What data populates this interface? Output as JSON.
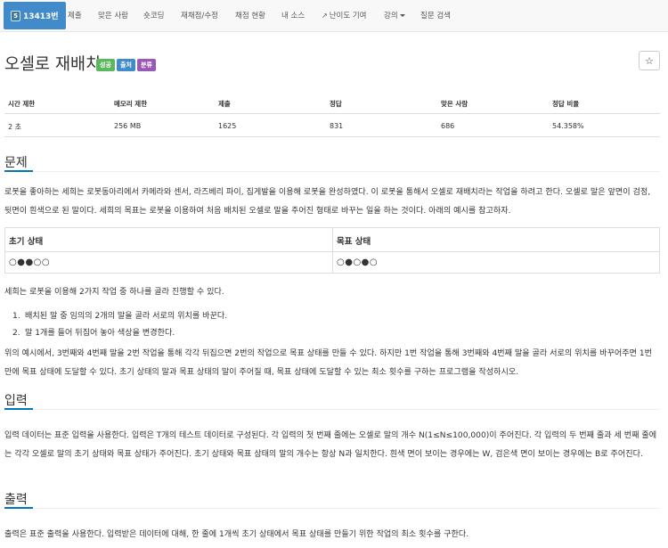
{
  "nav": {
    "problem_tab": "13413번",
    "tier_icon_label": "5",
    "items": [
      "제출",
      "맞은 사람",
      "숏코딩",
      "재채점/수정",
      "채점 현황",
      "내 소스",
      "난이도 기여",
      "강의",
      "질문 검색"
    ]
  },
  "problem": {
    "title": "오셀로 재배치",
    "labels": [
      {
        "text": "성공",
        "color": "#5cb85c"
      },
      {
        "text": "출처",
        "color": "#428bca"
      },
      {
        "text": "분류",
        "color": "#9b59b6"
      }
    ],
    "star_label": "☆"
  },
  "info": {
    "headers": [
      "시간 제한",
      "메모리 제한",
      "제출",
      "정답",
      "맞은 사람",
      "정답 비율"
    ],
    "values": [
      "2 초",
      "256 MB",
      "1625",
      "831",
      "686",
      "54.358%"
    ]
  },
  "sections": {
    "problem_heading": "문제",
    "problem_p1": "로봇을 좋아하는 세희는 로봇동아리에서 카메라와 센서, 라즈베리 파이, 집게발을 이용해 로봇을 완성하였다. 이 로봇을 통해서 오셀로 재배치라는 작업을 하려고 한다. 오셀로 말은 앞면이 검정, 뒷면이 흰색으로 된 말이다. 세희의 목표는 로봇을 이용하여 처음 배치된 오셀로 말을 주어진 형태로 바꾸는 일을 하는 것이다. 아래의 예시를 참고하자.",
    "state_headers": [
      "초기 상태",
      "목표 상태"
    ],
    "state_values": [
      "○●●○○",
      "○●○●○"
    ],
    "problem_p2": "세희는 로봇을 이용해 2가지 작업 중 하나를 골라 진행할 수 있다.",
    "ops": [
      "배치된 말 중 임의의 2개의 말을 골라 서로의 위치를 바꾼다.",
      "말 1개를 들어 뒤집어 놓아 색상을 변경한다."
    ],
    "problem_p3": "위의 예시에서, 3번째와 4번째 말을 2번 작업을 통해 각각 뒤집으면 2번의 작업으로 목표 상태를 만들 수 있다. 하지만 1번 작업을 통해 3번째와 4번째 말을 골라 서로의 위치를 바꾸어주면 1번 만에 목표 상태에 도달할 수 있다. 초기 상태의 말과 목표 상태의 말이 주어질 때, 목표 상태에 도달할 수 있는 최소 횟수를 구하는 프로그램을 작성하시오.",
    "input_heading": "입력",
    "input_p": "입력 데이터는 표준 입력을 사용한다. 입력은 T개의 테스트 데이터로 구성된다. 각 입력의 첫 번째 줄에는 오셀로 말의 개수 N(1≤N≤100,000)이 주어진다. 각 입력의 두 번째 줄과 세 번째 줄에는 각각 오셀로 말의 초기 상태와 목표 상태가 주어진다. 초기 상태와 목표 상태의 말의 개수는 항상 N과 일치한다. 흰색 면이 보이는 경우에는 W, 검은색 면이 보이는 경우에는 B로 주어진다.",
    "output_heading": "출력",
    "output_p": "출력은 표준 출력을 사용한다. 입력받은 데이터에 대해, 한 줄에 1개씩 초기 상태에서 목표 상태를 만들기 위한 작업의 최소 횟수를 구한다."
  }
}
